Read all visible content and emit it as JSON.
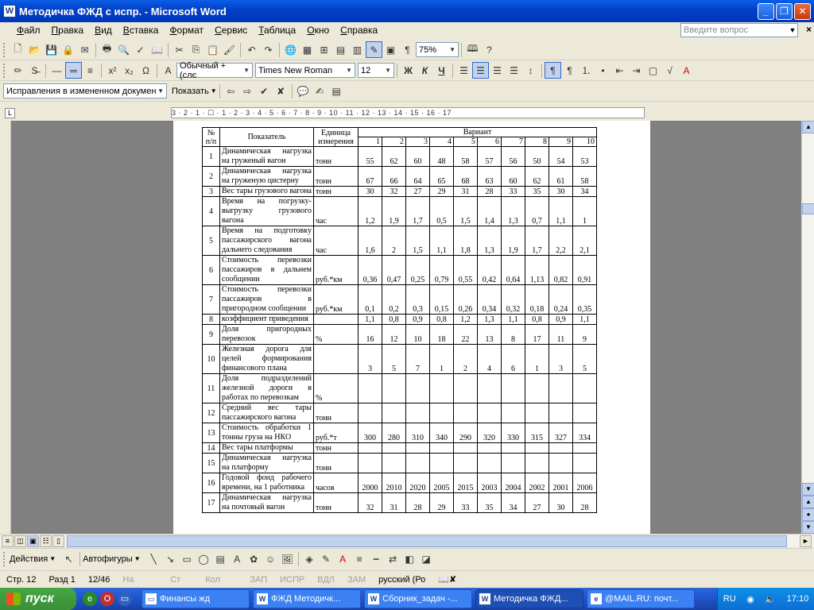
{
  "window": {
    "title": "Методичка ФЖД с испр. - Microsoft Word",
    "app_icon": "W"
  },
  "menu": [
    "Файл",
    "Правка",
    "Вид",
    "Вставка",
    "Формат",
    "Сервис",
    "Таблица",
    "Окно",
    "Справка"
  ],
  "ask_placeholder": "Введите вопрос",
  "toolbar": {
    "zoom": "75%",
    "style": "Обычный + (слє",
    "font": "Times New Roman",
    "size": "12"
  },
  "review": {
    "mode": "Исправления в измененном докумен",
    "show": "Показать"
  },
  "ruler_text": "3 · 2 · 1 · ☐ · 1 · 2 · 3 · 4 · 5 · 6 · 7 · 8 · 9 · 10 · 11 · 12 · 13 · 14 · 15 · 16 · 17",
  "table": {
    "h_no": "№ п/п",
    "h_ind": "Показатель",
    "h_unit": "Единица измерения",
    "h_var": "Вариант",
    "variants": [
      "1",
      "2",
      "3",
      "4",
      "5",
      "6",
      "7",
      "8",
      "9",
      "10"
    ],
    "rows": [
      {
        "n": "1",
        "ind": "Динамическая нагрузка на груженый вагон",
        "unit": "тонн",
        "v": [
          "55",
          "62",
          "60",
          "48",
          "58",
          "57",
          "56",
          "50",
          "54",
          "53"
        ]
      },
      {
        "n": "2",
        "ind": "Динамическая нагрузка на груженую цистерну",
        "unit": "тонн",
        "v": [
          "67",
          "66",
          "64",
          "65",
          "68",
          "63",
          "60",
          "62",
          "61",
          "58"
        ]
      },
      {
        "n": "3",
        "ind": "Вес тары грузового вагона",
        "unit": "тонн",
        "v": [
          "30",
          "32",
          "27",
          "29",
          "31",
          "28",
          "33",
          "35",
          "30",
          "34"
        ]
      },
      {
        "n": "4",
        "ind": "Время на погрузку-выгрузку грузового вагона",
        "unit": "час",
        "v": [
          "1,2",
          "1,9",
          "1,7",
          "0,5",
          "1,5",
          "1,4",
          "1,3",
          "0,7",
          "1,1",
          "1"
        ]
      },
      {
        "n": "5",
        "ind": "Время на подготовку пассажирского вагона дальнего следования",
        "unit": "час",
        "v": [
          "1,6",
          "2",
          "1,5",
          "1,1",
          "1,8",
          "1,3",
          "1,9",
          "1,7",
          "2,2",
          "2,1"
        ]
      },
      {
        "n": "6",
        "ind": "Стоимость перевозки пассажиров в дальнем сообщении",
        "unit": "руб.*км",
        "v": [
          "0,36",
          "0,47",
          "0,25",
          "0,79",
          "0,55",
          "0,42",
          "0,64",
          "1,13",
          "0,82",
          "0,91"
        ]
      },
      {
        "n": "7",
        "ind": "Стоимость перевозки пассажиров в пригородном сообщении",
        "unit": "руб.*км",
        "v": [
          "0,1",
          "0,2",
          "0,3",
          "0,15",
          "0,26",
          "0,34",
          "0,32",
          "0,18",
          "0,24",
          "0,35"
        ]
      },
      {
        "n": "8",
        "ind": "коэффициент приведения",
        "unit": "",
        "v": [
          "1,1",
          "0,8",
          "0,9",
          "0,8",
          "1,2",
          "1,3",
          "1,1",
          "0,8",
          "0,9",
          "1,1"
        ]
      },
      {
        "n": "9",
        "ind": "Доля пригородных перевозок",
        "unit": "%",
        "v": [
          "16",
          "12",
          "10",
          "18",
          "22",
          "13",
          "8",
          "17",
          "11",
          "9"
        ]
      },
      {
        "n": "10",
        "ind": "Железная дорога для целей формирования финансового плана",
        "unit": "",
        "v": [
          "3",
          "5",
          "7",
          "1",
          "2",
          "4",
          "6",
          "1",
          "3",
          "5"
        ]
      },
      {
        "n": "11",
        "ind": "Доля подразделений железной дороги в работах по перевозкам",
        "unit": "%",
        "v": [
          "",
          "",
          "",
          "",
          "",
          "",
          "",
          "",
          "",
          ""
        ]
      },
      {
        "n": "12",
        "ind": "Средний вес тары пассажирского вагона",
        "unit": "тонн",
        "v": [
          "",
          "",
          "",
          "",
          "",
          "",
          "",
          "",
          "",
          ""
        ]
      },
      {
        "n": "13",
        "ind": "Стоимость обработки 1 тонны груза на НКО",
        "unit": "руб.*т",
        "v": [
          "300",
          "280",
          "310",
          "340",
          "290",
          "320",
          "330",
          "315",
          "327",
          "334"
        ]
      },
      {
        "n": "14",
        "ind": "Вес тары платформы",
        "unit": "тонн",
        "v": [
          "",
          "",
          "",
          "",
          "",
          "",
          "",
          "",
          "",
          ""
        ]
      },
      {
        "n": "15",
        "ind": "Динамическая нагрузка на платформу",
        "unit": "тонн",
        "v": [
          "",
          "",
          "",
          "",
          "",
          "",
          "",
          "",
          "",
          ""
        ]
      },
      {
        "n": "16",
        "ind": "Годовой фонд рабочего времени, на 1 работника",
        "unit": "часов",
        "v": [
          "2000",
          "2010",
          "2020",
          "2005",
          "2015",
          "2003",
          "2004",
          "2002",
          "2001",
          "2006"
        ]
      },
      {
        "n": "17",
        "ind": "Динамическая нагрузка на почтовый вагон",
        "unit": "тонн",
        "v": [
          "32",
          "31",
          "28",
          "29",
          "33",
          "35",
          "34",
          "27",
          "30",
          "28"
        ]
      }
    ]
  },
  "drawbar": {
    "actions": "Действия",
    "autoshapes": "Автофигуры"
  },
  "status": {
    "page": "Стр. 12",
    "section": "Разд 1",
    "pages": "12/46",
    "at": "На",
    "ln": "Ст",
    "col": "Кол",
    "rec": "ЗАП",
    "trk": "ИСПР",
    "ext": "ВДЛ",
    "ovr": "ЗАМ",
    "lang": "русский (Ро"
  },
  "taskbar": {
    "start": "пуск",
    "tasks": [
      "Финансы жд",
      "ФЖД Методичк...",
      "Сборник_задач -...",
      "Методичка ФЖД...",
      "@MAIL.RU: почт..."
    ],
    "active": 3,
    "lang": "RU",
    "clock": "17:10"
  }
}
